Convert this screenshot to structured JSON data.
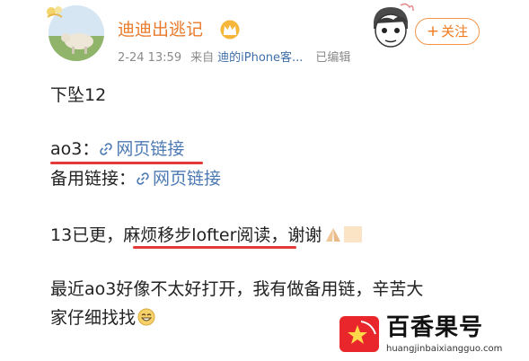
{
  "post": {
    "username": "迪迪出逃记",
    "date": "2-24 13:59",
    "source_prefix": "来自",
    "device": "迪的iPhone客...",
    "edited": "已编辑",
    "follow_plus": "+",
    "follow_label": "关注"
  },
  "content": {
    "line1": "下坠12",
    "ao3_label": "ao3：",
    "ao3_link": "网页链接",
    "backup_label": "备用链接：",
    "backup_link": "网页链接",
    "line4_prefix": "13已更，",
    "line4_highlight": "麻烦移步lofter阅读",
    "line4_suffix": "，谢谢",
    "line5": "最近ao3好像不太好打开，我有做备用链，辛苦大",
    "line6": "家仔细找找"
  },
  "watermark": {
    "title": "百香果号",
    "url": "huangjinbaixiangguo.com"
  },
  "colors": {
    "username": "#e97a2b",
    "link": "#4d7ab3",
    "follow": "#f07a1d",
    "underline": "#e23a3a",
    "watermark_red": "#e8262b"
  },
  "icons": [
    "sheep-avatar",
    "crown-icon",
    "cartoon-sticker",
    "link-icon",
    "praying-hands-emoji",
    "grin-emoji",
    "star-logo-icon"
  ]
}
